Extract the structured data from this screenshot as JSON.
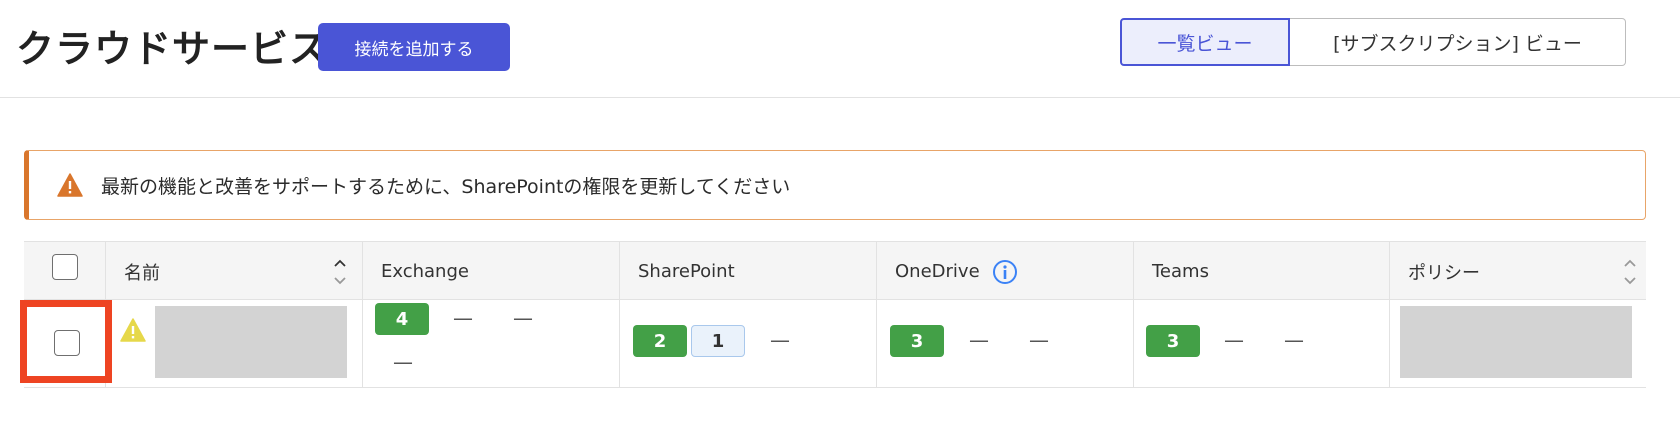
{
  "header": {
    "title": "クラウドサービス",
    "add_button": "接続を追加する",
    "view_list": "一覧ビュー",
    "view_subscription": "[サブスクリプション] ビュー"
  },
  "alert": {
    "text": "最新の機能と改善をサポートするために、SharePointの権限を更新してください",
    "accent_color": "#d9762c"
  },
  "table": {
    "columns": [
      "名前",
      "Exchange",
      "SharePoint",
      "OneDrive",
      "Teams",
      "ポリシー"
    ],
    "rows": [
      {
        "exchange": {
          "badge": "4",
          "dashes": [
            "—",
            "—",
            "—"
          ]
        },
        "sharepoint": {
          "badge": "2",
          "badge_secondary": "1",
          "dashes": [
            "—"
          ]
        },
        "onedrive": {
          "badge": "3",
          "dashes": [
            "—",
            "—"
          ]
        },
        "teams": {
          "badge": "3",
          "dashes": [
            "—",
            "—"
          ]
        }
      }
    ]
  },
  "colors": {
    "primary": "#4a55d6",
    "success": "#43a047",
    "warning": "#d9762c",
    "highlight": "#ee4422"
  }
}
